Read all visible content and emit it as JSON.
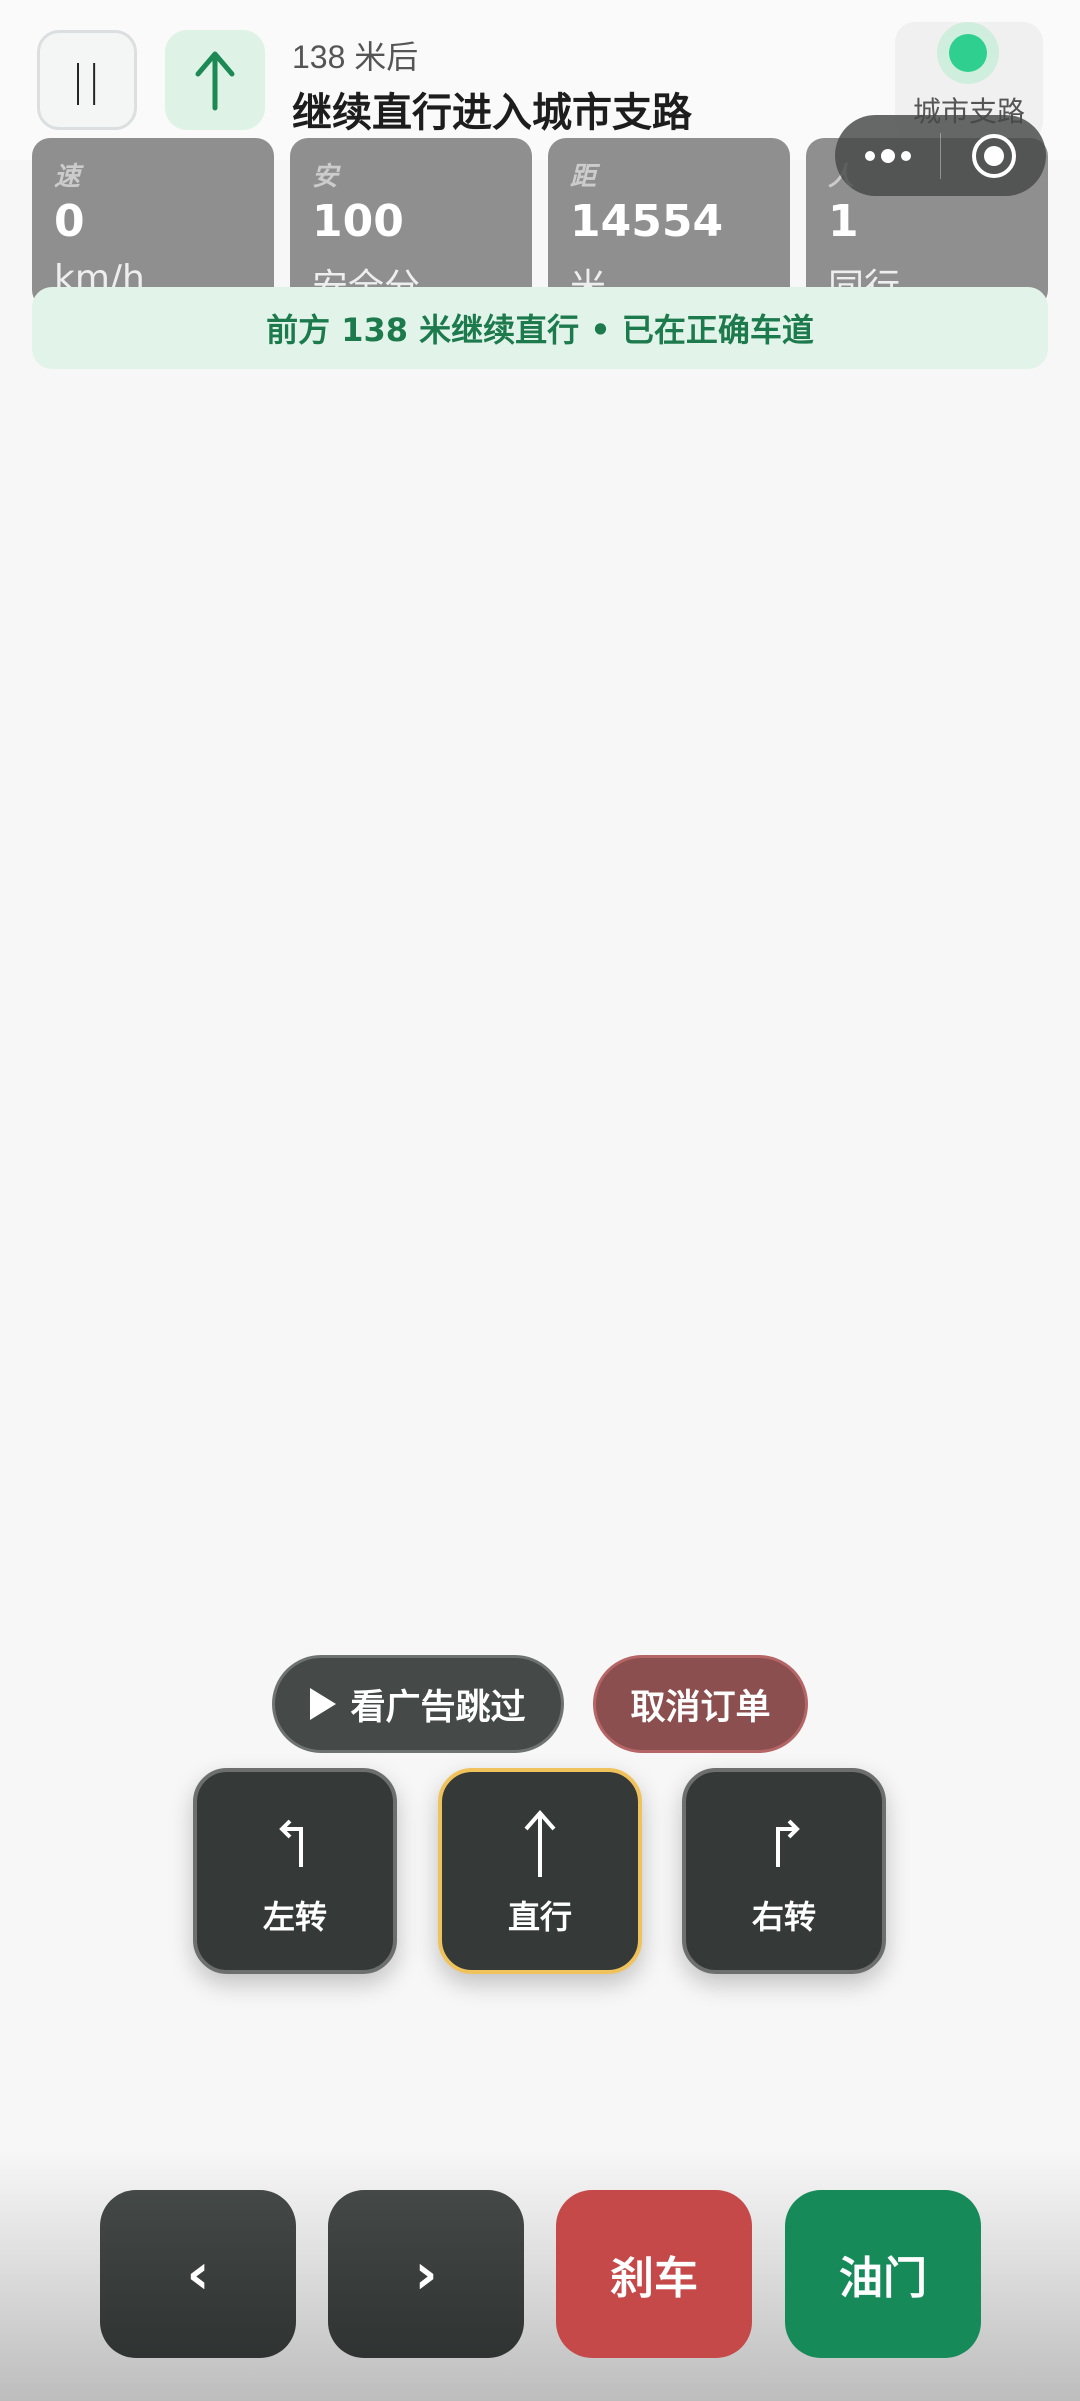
{
  "nav": {
    "pause_glyph": "||",
    "direction_icon": "arrow-up-icon",
    "distance": "138 米后",
    "instruction": "继续直行进入城市支路",
    "road_name": "城市支路",
    "colors": {
      "primary_green": "#1d7a4d",
      "road_dot": "#2fcf8f"
    }
  },
  "capsule": {
    "more_icon": "more-dots-icon",
    "close_icon": "target-close-icon"
  },
  "stats": [
    {
      "label": "速",
      "value": "0",
      "unit": "km/h"
    },
    {
      "label": "安",
      "value": "100",
      "unit": "安全分"
    },
    {
      "label": "距",
      "value": "14554",
      "unit": "米"
    },
    {
      "label": "人",
      "value": "1",
      "unit": "同行"
    }
  ],
  "status": "前方 138 米继续直行 • 已在正确车道",
  "actions": {
    "ad_skip": "看广告跳过",
    "cancel_order": "取消订单"
  },
  "turns": [
    {
      "icon": "turn-left-icon",
      "label": "左转"
    },
    {
      "icon": "straight-icon",
      "label": "直行",
      "active": true
    },
    {
      "icon": "turn-right-icon",
      "label": "右转"
    }
  ],
  "controls": {
    "prev": "‹",
    "next": "›",
    "brake": "刹车",
    "gas": "油门",
    "colors": {
      "brake": "#c6494a",
      "gas": "#178a5a"
    }
  }
}
